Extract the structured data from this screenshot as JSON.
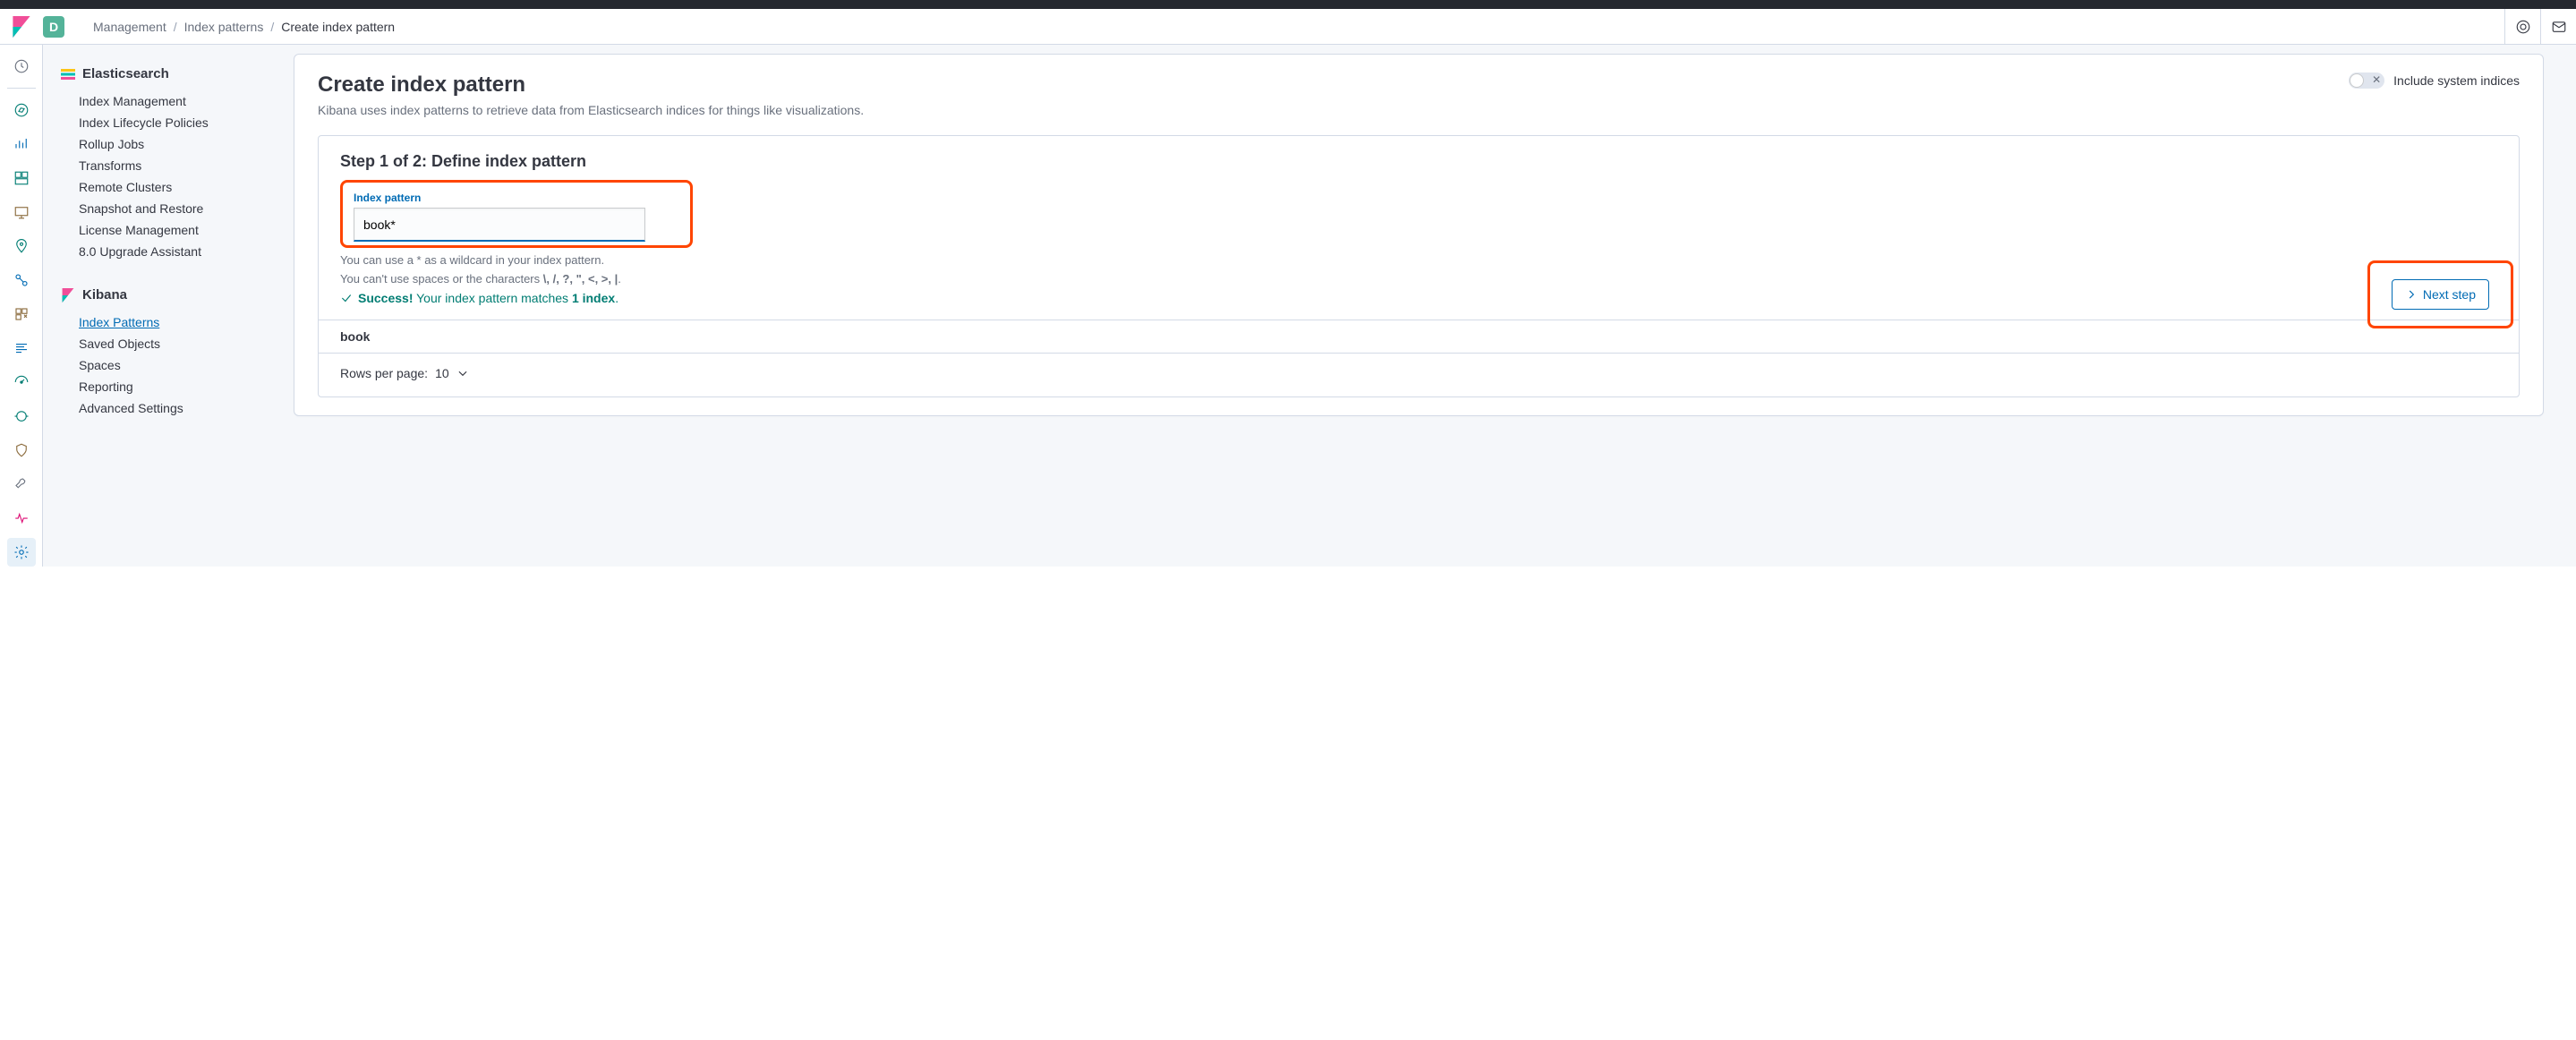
{
  "header": {
    "space_initial": "D",
    "breadcrumb": [
      "Management",
      "Index patterns",
      "Create index pattern"
    ]
  },
  "nav_icons": [
    "recent-icon",
    "discover-icon",
    "visualize-icon",
    "dashboard-icon",
    "canvas-icon",
    "maps-icon",
    "ml-icon",
    "infra-icon",
    "logs-icon",
    "apm-icon",
    "uptime-icon",
    "siem-icon",
    "devtools-icon",
    "monitoring-icon",
    "management-icon"
  ],
  "sidebar": {
    "groups": [
      {
        "title": "Elasticsearch",
        "items": [
          "Index Management",
          "Index Lifecycle Policies",
          "Rollup Jobs",
          "Transforms",
          "Remote Clusters",
          "Snapshot and Restore",
          "License Management",
          "8.0 Upgrade Assistant"
        ]
      },
      {
        "title": "Kibana",
        "items": [
          "Index Patterns",
          "Saved Objects",
          "Spaces",
          "Reporting",
          "Advanced Settings"
        ],
        "active_index": 0
      }
    ]
  },
  "page": {
    "title": "Create index pattern",
    "description": "Kibana uses index patterns to retrieve data from Elasticsearch indices for things like visualizations.",
    "include_system_label": "Include system indices",
    "include_system_on": false
  },
  "step": {
    "title": "Step 1 of 2: Define index pattern",
    "field_label": "Index pattern",
    "field_value": "book*",
    "help1": "You can use a * as a wildcard in your index pattern.",
    "help2_prefix": "You can't use spaces or the characters ",
    "help2_chars": "\\, /, ?, \", <, >, |",
    "help2_suffix": ".",
    "success_prefix": "Success!",
    "success_rest": " Your index pattern matches ",
    "success_count": "1 index",
    "success_end": ".",
    "next_label": "Next step",
    "matches": [
      "book"
    ],
    "rows_per_page_label": "Rows per page: ",
    "rows_per_page_value": "10"
  }
}
